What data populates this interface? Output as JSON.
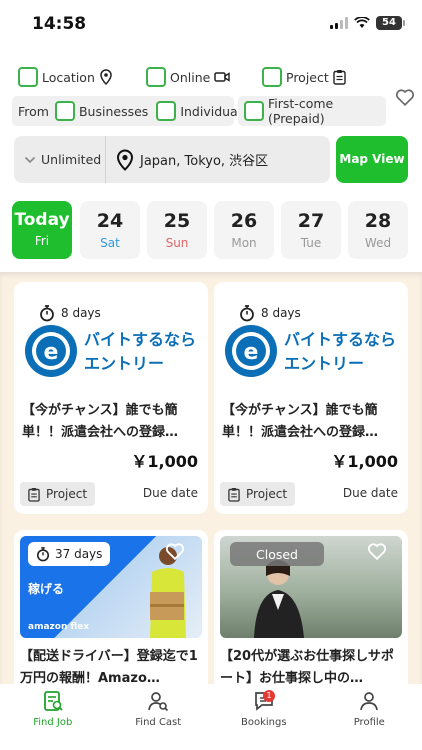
{
  "status": {
    "time": "14:58",
    "battery": "54"
  },
  "filters": {
    "row1": [
      "Location",
      "Online",
      "Project"
    ],
    "from_label": "From",
    "from_options": [
      "Businesses",
      "Individuals"
    ],
    "first_come": "First-come (Prepaid)"
  },
  "search": {
    "range": "Unlimited",
    "location": "Japan, Tokyo, 渋谷区",
    "map_button": "Map View"
  },
  "dates": [
    {
      "num": "Today",
      "day": "Fri"
    },
    {
      "num": "24",
      "day": "Sat"
    },
    {
      "num": "25",
      "day": "Sun"
    },
    {
      "num": "26",
      "day": "Mon"
    },
    {
      "num": "27",
      "day": "Tue"
    },
    {
      "num": "28",
      "day": "Wed"
    }
  ],
  "colors": {
    "accent": "#1fbe2e",
    "sat": "#2f9be0",
    "sun": "#e06666",
    "listing_bg": "#fbf1e3"
  },
  "listings": [
    {
      "days": "8 days",
      "logo_text": "バイトするなら エントリー",
      "title": "【今がチャンス】誰でも簡単！！派遣会社への登録…",
      "price": "￥1,000",
      "tag": "Project",
      "due": "Due date"
    },
    {
      "days": "8 days",
      "logo_text": "バイトするなら エントリー",
      "title": "【今がチャンス】誰でも簡単！！派遣会社への登録…",
      "price": "￥1,000",
      "tag": "Project",
      "due": "Due date"
    },
    {
      "days": "37 days",
      "image_text": "稼げる",
      "image_brand": "amazon flex",
      "title": "【配送ドライバー】登録迄で1万円の報酬！Amazo…"
    },
    {
      "status": "Closed",
      "title": "【20代が選ぶお仕事探しサポート】お仕事探し中の…"
    }
  ],
  "tabs": [
    {
      "label": "Find Job",
      "icon": "find-job-icon"
    },
    {
      "label": "Find Cast",
      "icon": "find-cast-icon"
    },
    {
      "label": "Bookings",
      "icon": "bookings-icon",
      "badge": "1"
    },
    {
      "label": "Profile",
      "icon": "profile-icon"
    }
  ]
}
